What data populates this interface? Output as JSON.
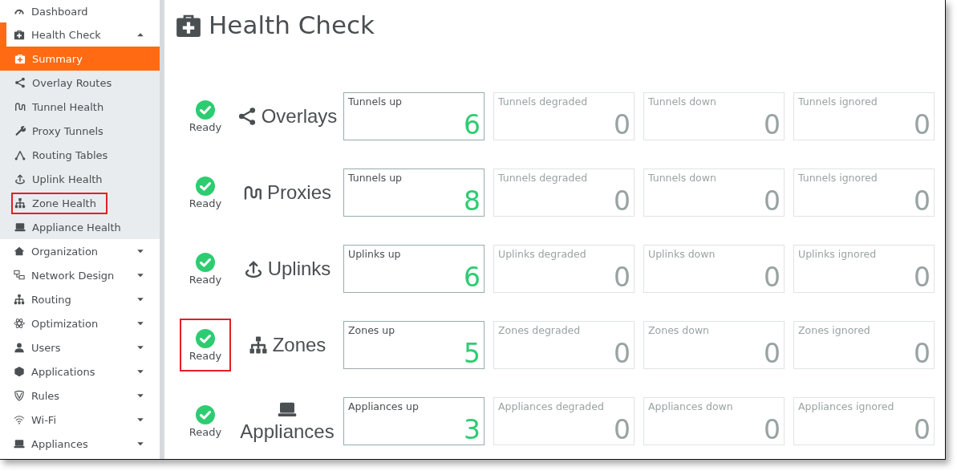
{
  "sidebar": {
    "items": [
      {
        "label": "Dashboard"
      },
      {
        "label": "Health Check",
        "expanded": true,
        "children": [
          {
            "label": "Summary",
            "selected": true
          },
          {
            "label": "Overlay Routes",
            "selected": false
          },
          {
            "label": "Tunnel Health",
            "selected": false
          },
          {
            "label": "Proxy Tunnels",
            "selected": false
          },
          {
            "label": "Routing Tables",
            "selected": false
          },
          {
            "label": "Uplink Health",
            "selected": false
          },
          {
            "label": "Zone Health",
            "selected": false,
            "highlighted": true
          },
          {
            "label": "Appliance Health",
            "selected": false
          }
        ]
      },
      {
        "label": "Organization",
        "expanded": false
      },
      {
        "label": "Network Design",
        "expanded": false
      },
      {
        "label": "Routing",
        "expanded": false
      },
      {
        "label": "Optimization",
        "expanded": false
      },
      {
        "label": "Users",
        "expanded": false
      },
      {
        "label": "Applications",
        "expanded": false
      },
      {
        "label": "Rules",
        "expanded": false
      },
      {
        "label": "Wi-Fi",
        "expanded": false
      },
      {
        "label": "Appliances",
        "expanded": false
      }
    ]
  },
  "page": {
    "title": "Health Check"
  },
  "checks": [
    {
      "status": "Ready",
      "ok": true,
      "name": "Overlays",
      "tiles": [
        {
          "label": "Tunnels up",
          "value": "6",
          "active": true
        },
        {
          "label": "Tunnels degraded",
          "value": "0",
          "active": false
        },
        {
          "label": "Tunnels down",
          "value": "0",
          "active": false
        },
        {
          "label": "Tunnels ignored",
          "value": "0",
          "active": false
        }
      ]
    },
    {
      "status": "Ready",
      "ok": true,
      "name": "Proxies",
      "tiles": [
        {
          "label": "Tunnels up",
          "value": "8",
          "active": true
        },
        {
          "label": "Tunnels degraded",
          "value": "0",
          "active": false
        },
        {
          "label": "Tunnels down",
          "value": "0",
          "active": false
        },
        {
          "label": "Tunnels ignored",
          "value": "0",
          "active": false
        }
      ]
    },
    {
      "status": "Ready",
      "ok": true,
      "name": "Uplinks",
      "tiles": [
        {
          "label": "Uplinks up",
          "value": "6",
          "active": true
        },
        {
          "label": "Uplinks degraded",
          "value": "0",
          "active": false
        },
        {
          "label": "Uplinks down",
          "value": "0",
          "active": false
        },
        {
          "label": "Uplinks ignored",
          "value": "0",
          "active": false
        }
      ]
    },
    {
      "status": "Ready",
      "ok": true,
      "highlighted": true,
      "name": "Zones",
      "tiles": [
        {
          "label": "Zones up",
          "value": "5",
          "active": true
        },
        {
          "label": "Zones degraded",
          "value": "0",
          "active": false
        },
        {
          "label": "Zones down",
          "value": "0",
          "active": false
        },
        {
          "label": "Zones ignored",
          "value": "0",
          "active": false
        }
      ]
    },
    {
      "status": "Ready",
      "ok": true,
      "name": "Appliances",
      "tiles": [
        {
          "label": "Appliances up",
          "value": "3",
          "active": true
        },
        {
          "label": "Appliances degraded",
          "value": "0",
          "active": false
        },
        {
          "label": "Appliances down",
          "value": "0",
          "active": false
        },
        {
          "label": "Appliances ignored",
          "value": "0",
          "active": false
        }
      ]
    }
  ]
}
